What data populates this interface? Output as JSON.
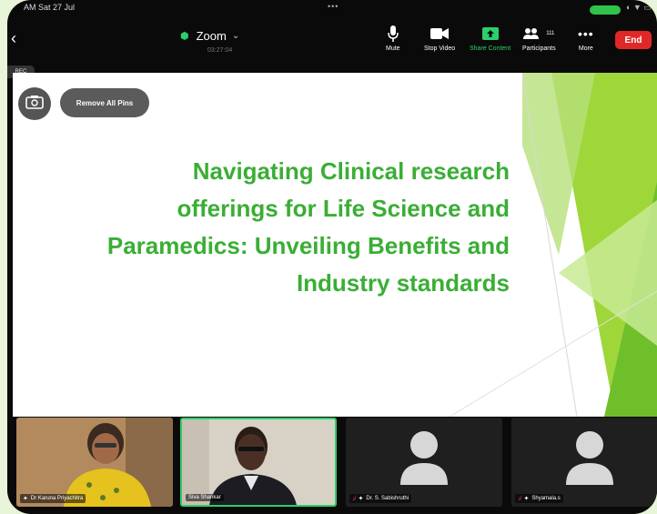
{
  "status_bar": {
    "time": "AM  Sat 27 Jul",
    "dots": "•••"
  },
  "toolbar": {
    "title": "Zoom",
    "timer": "03:27:04",
    "buttons": [
      {
        "label": "Mute",
        "icon": "microphone-icon"
      },
      {
        "label": "Stop Video",
        "icon": "video-camera-icon"
      },
      {
        "label": "Share Content",
        "icon": "share-screen-icon"
      },
      {
        "label": "Participants",
        "icon": "participants-icon",
        "count": "111"
      },
      {
        "label": "More",
        "icon": "more-icon"
      }
    ],
    "end_label": "End"
  },
  "rec_label": "REC",
  "remove_pins_label": "Remove All Pins",
  "slide": {
    "title": "Navigating Clinical research offerings for Life Science and Paramedics: Unveiling Benefits and Industry standards"
  },
  "participants": [
    {
      "name": "Dr Karuna Priyachitra",
      "muted": false
    },
    {
      "name": "Siva Shankar",
      "muted": false
    },
    {
      "name": "Dr. S. Sabishruthi",
      "muted": true
    },
    {
      "name": "Shyamala.s",
      "muted": true
    }
  ],
  "colors": {
    "accent_green": "#3aae35",
    "end_red": "#e02828",
    "active_green": "#2bd06a",
    "background": "#e8f5d8"
  }
}
